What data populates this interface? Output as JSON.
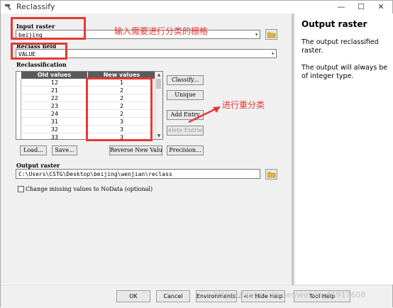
{
  "window": {
    "title": "Reclassify",
    "min_glyph": "—",
    "max_glyph": "☐",
    "close_glyph": "✕"
  },
  "form": {
    "input_raster_label": "Input raster",
    "input_raster_value": "beijing",
    "reclass_field_label": "Reclass field",
    "reclass_field_value": "VALUE",
    "reclassification_label": "Reclassification",
    "output_raster_label": "Output raster",
    "output_raster_value": "C:\\Users\\CSTG\\Desktop\\beijing\\wenjian\\reclass",
    "missing_nodata_label": "Change missing values to NoData (optional)"
  },
  "table": {
    "col_old": "Old values",
    "col_new": "New values",
    "rows": [
      {
        "old": "12",
        "new": "1"
      },
      {
        "old": "21",
        "new": "2"
      },
      {
        "old": "22",
        "new": "2"
      },
      {
        "old": "23",
        "new": "2"
      },
      {
        "old": "24",
        "new": "2"
      },
      {
        "old": "31",
        "new": "3"
      },
      {
        "old": "32",
        "new": "3"
      },
      {
        "old": "33",
        "new": "3"
      }
    ]
  },
  "buttons": {
    "classify": "Classify...",
    "unique": "Unique",
    "add_entry": "Add Entry",
    "delete_entries": "elete Entrie",
    "load": "Load...",
    "save": "Save...",
    "reverse": "Reverse New Values",
    "precision": "Precision..."
  },
  "bottom": {
    "ok": "OK",
    "cancel": "Cancel",
    "environments": "Environments...",
    "hide_help": "<< Hide Help",
    "tool_help": "Tool Help",
    "watermark": "https://blog.csdn.net/weixin_41917608"
  },
  "annotations": {
    "input_note": "输入需要进行分类的栅格",
    "reclass_note": "进行重分类"
  },
  "help": {
    "title": "Output raster",
    "para1": "The output reclassified raster.",
    "para2": "The output will always be of integer type."
  },
  "colors": {
    "annotation_red": "#e53935",
    "header_bg": "#5b5b5b"
  },
  "icons": {
    "app": "hammer-icon",
    "folder": "open-folder-icon",
    "dropdown": "chevron-down-icon"
  }
}
